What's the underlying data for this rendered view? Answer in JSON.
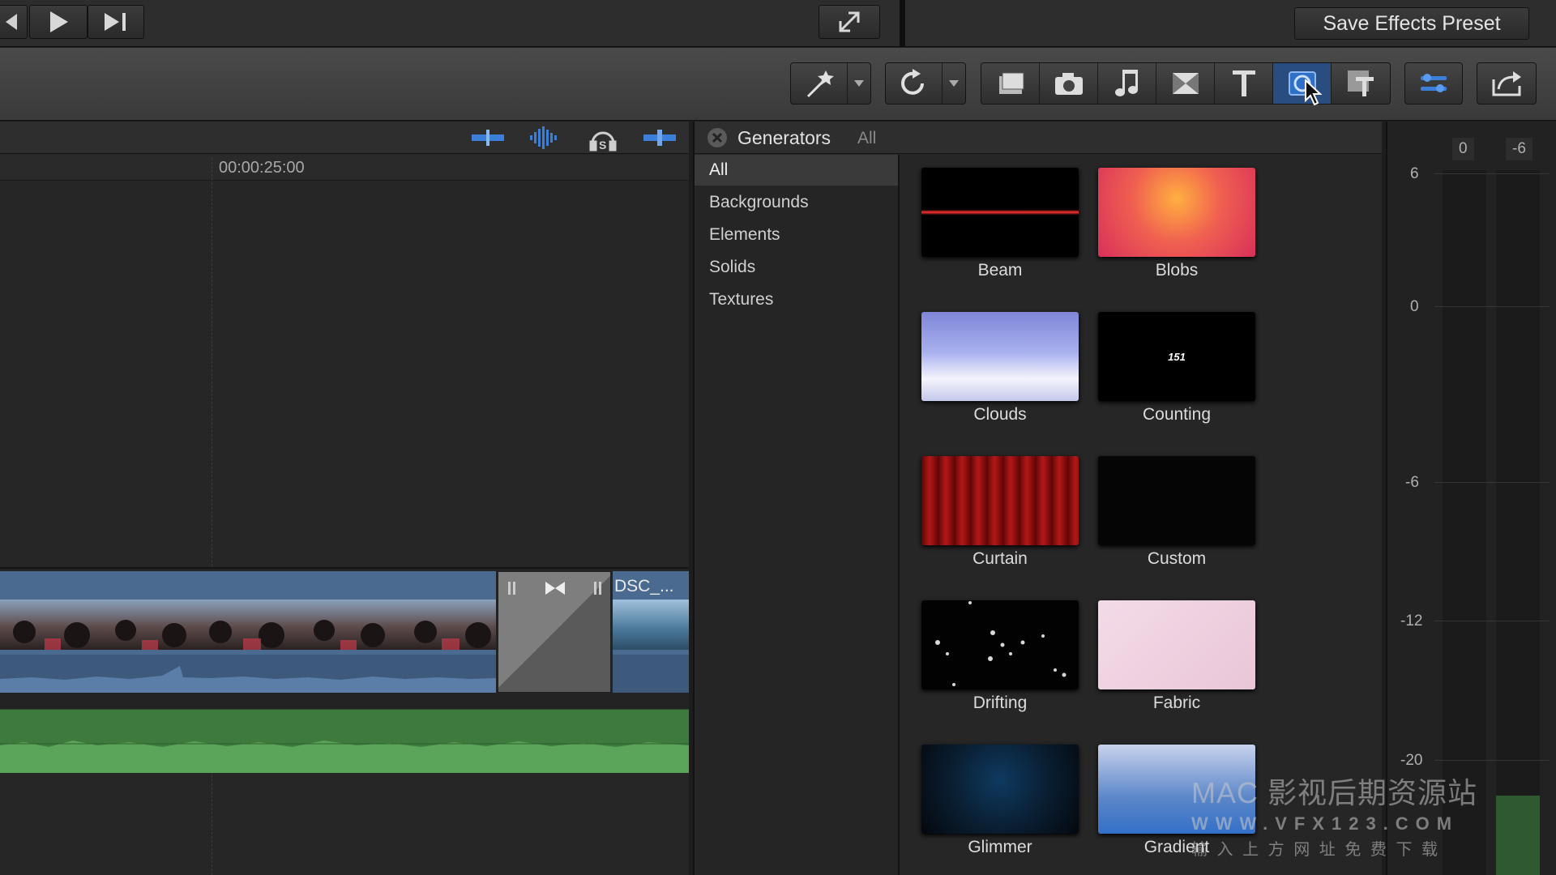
{
  "topbar": {
    "save_preset_label": "Save Effects Preset"
  },
  "timeline": {
    "timecode": "00:00:25:00",
    "clip_label": "DSC_..."
  },
  "generators": {
    "title": "Generators",
    "filter": "All",
    "categories": [
      "All",
      "Backgrounds",
      "Elements",
      "Solids",
      "Textures"
    ],
    "selected_category": "All",
    "items": [
      {
        "label": "Beam",
        "color": "#000000"
      },
      {
        "label": "Blobs",
        "color": "#e8456a"
      },
      {
        "label": "Clouds",
        "color": "#9aa4e0"
      },
      {
        "label": "Counting",
        "color": "#000000",
        "overlay": "151"
      },
      {
        "label": "Curtain",
        "color": "#8a0e0e"
      },
      {
        "label": "Custom",
        "color": "#050505"
      },
      {
        "label": "Drifting",
        "color": "#020202"
      },
      {
        "label": "Fabric",
        "color": "#f0d4e2"
      },
      {
        "label": "Glimmer",
        "color": "#0a1f33"
      },
      {
        "label": "Gradient",
        "color": "#5b86c9"
      }
    ]
  },
  "meters": {
    "headers": [
      "0",
      "-6"
    ],
    "scale": [
      "6",
      "0",
      "-6",
      "-12",
      "-20"
    ]
  },
  "watermark": {
    "line1": "MAC 影视后期资源站",
    "line2": "WWW.VFX123.COM",
    "line3": "输 入 上 方 网 址   免 费 下 载"
  },
  "colors": {
    "accent": "#3b7fd9",
    "audio_green": "#3e7a3e",
    "clip_blue": "#4a6a90"
  }
}
